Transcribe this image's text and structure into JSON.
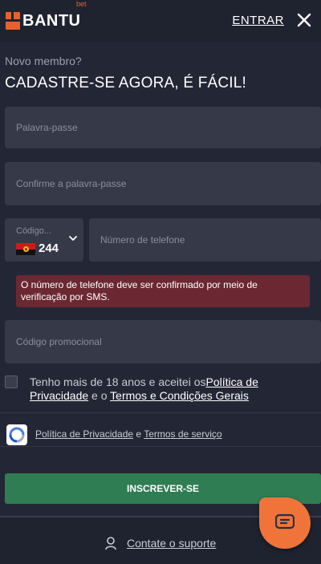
{
  "header": {
    "logo_text": "BANTU",
    "logo_sup": "bet",
    "login_label": "ENTRAR",
    "close_icon": "close-icon"
  },
  "intro": {
    "subtitle": "Novo membro?",
    "headline": "CADASTRE-SE AGORA, É FÁCIL!"
  },
  "form": {
    "password_placeholder": "Palavra-passe",
    "confirm_password_placeholder": "Confirme a palavra-passe",
    "country_code_label": "Código...",
    "country_code_value": "244",
    "country_flag": "angola-flag",
    "phone_placeholder": "Número de telefone",
    "phone_error": "O número de telefone deve ser confirmado por meio de verificação por SMS.",
    "promo_placeholder": "Código promocional"
  },
  "terms": {
    "prefix": "Tenho mais de 18 anos e aceitei os",
    "privacy_link": "Política de Privacidade",
    "conjunction": " e o ",
    "terms_link": "Termos e Condições Gerais"
  },
  "captcha": {
    "privacy_link": "Política de Privacidade",
    "conjunction": " e ",
    "terms_link": "Termos de serviço"
  },
  "submit_label": "INSCREVER-SE",
  "footer": {
    "support_label": "Contate o suporte"
  },
  "colors": {
    "background": "#232735",
    "field": "#363a48",
    "accent": "#e8612c",
    "submit": "#2f7d53",
    "error": "#6b2833"
  }
}
